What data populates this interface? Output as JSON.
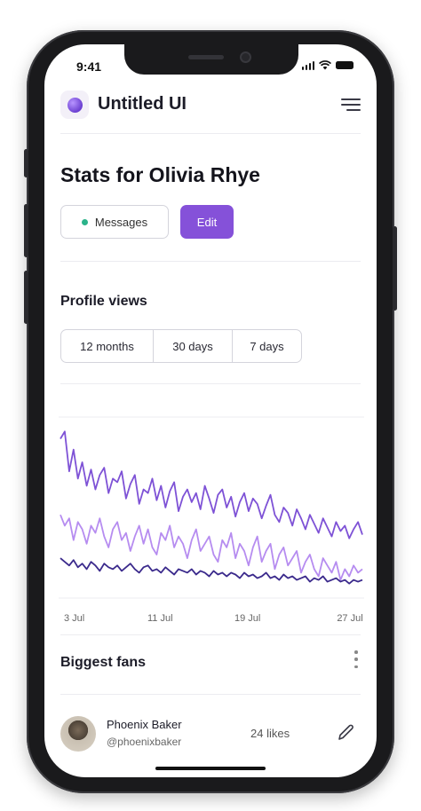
{
  "status_bar": {
    "time": "9:41"
  },
  "header": {
    "brand": "Untitled UI"
  },
  "page": {
    "title": "Stats for Olivia Rhye",
    "messages_button": "Messages",
    "edit_button": "Edit"
  },
  "profile_views": {
    "title": "Profile views",
    "tabs": [
      {
        "label": "12 months"
      },
      {
        "label": "30 days"
      },
      {
        "label": "7 days"
      }
    ]
  },
  "chart_data": {
    "type": "line",
    "x_tick_labels": [
      "3 Jul",
      "11 Jul",
      "19 Jul",
      "27 Jul"
    ],
    "grid": true,
    "colors": [
      "#7e52d6",
      "#b68cf0",
      "#3b2a8c"
    ],
    "series": [
      {
        "values": [
          88,
          92,
          70,
          82,
          66,
          75,
          62,
          71,
          60,
          68,
          72,
          58,
          66,
          64,
          70,
          55,
          63,
          68,
          52,
          60,
          58,
          66,
          54,
          62,
          50,
          59,
          64,
          48,
          56,
          60,
          53,
          58,
          49,
          62,
          55,
          47,
          57,
          60,
          50,
          56,
          45,
          53,
          58,
          48,
          55,
          52,
          44,
          51,
          57,
          46,
          42,
          50,
          47,
          40,
          49,
          44,
          38,
          46,
          41,
          36,
          44,
          39,
          34,
          42,
          37,
          40,
          33,
          38,
          42,
          35
        ]
      },
      {
        "values": [
          46,
          40,
          44,
          32,
          42,
          38,
          30,
          40,
          36,
          44,
          34,
          28,
          38,
          42,
          32,
          36,
          26,
          34,
          40,
          30,
          38,
          28,
          24,
          36,
          32,
          40,
          28,
          34,
          30,
          22,
          32,
          38,
          26,
          30,
          34,
          24,
          20,
          32,
          28,
          36,
          22,
          30,
          26,
          18,
          28,
          34,
          20,
          26,
          30,
          16,
          24,
          28,
          18,
          22,
          26,
          14,
          20,
          24,
          16,
          12,
          22,
          18,
          14,
          20,
          10,
          16,
          12,
          18,
          14,
          16
        ]
      },
      {
        "values": [
          22,
          20,
          18,
          21,
          17,
          19,
          16,
          20,
          18,
          15,
          19,
          17,
          16,
          18,
          15,
          17,
          19,
          16,
          14,
          17,
          18,
          15,
          16,
          14,
          17,
          15,
          13,
          16,
          15,
          14,
          16,
          13,
          15,
          14,
          12,
          15,
          13,
          14,
          12,
          14,
          13,
          11,
          14,
          12,
          13,
          11,
          12,
          14,
          11,
          12,
          10,
          13,
          11,
          12,
          10,
          11,
          12,
          9,
          11,
          10,
          12,
          9,
          10,
          11,
          9,
          10,
          8,
          10,
          9,
          10
        ]
      }
    ]
  },
  "biggest_fans": {
    "title": "Biggest fans",
    "fans": [
      {
        "name": "Phoenix Baker",
        "handle": "@phoenixbaker",
        "likes": "24 likes"
      }
    ]
  }
}
